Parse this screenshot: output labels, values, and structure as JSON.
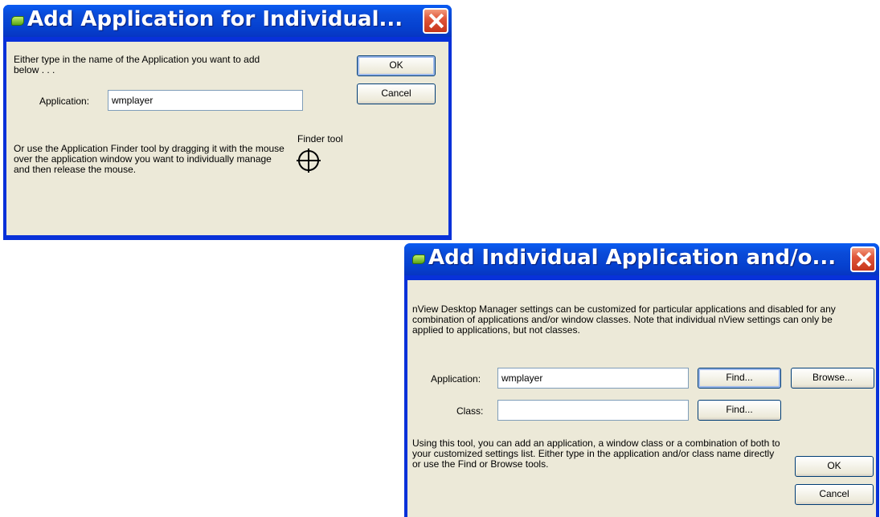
{
  "dialog1": {
    "title": "Add Application for Individual...",
    "intro": "Either type in the name of the Application you want to add below . . .",
    "application_label": "Application:",
    "application_value": "wmplayer",
    "finder_text": "Or use the Application Finder tool by dragging it with the mouse over the application window you want to individually manage and then release the mouse.",
    "finder_label": "Finder tool",
    "ok_label": "OK",
    "cancel_label": "Cancel"
  },
  "dialog2": {
    "title": "Add Individual Application and/o...",
    "intro": "nView Desktop Manager settings can be customized for particular applications and disabled for any combination of applications and/or window classes. Note that individual nView settings can only be applied to applications, but not classes.",
    "application_label": "Application:",
    "application_value": "wmplayer",
    "class_label": "Class:",
    "class_value": "",
    "find_label": "Find...",
    "browse_label": "Browse...",
    "footer_text": "Using this tool, you can add an application, a window class or a combination of both to your customized settings list. Either type in the application and/or class name directly or use the Find or Browse tools.",
    "ok_label": "OK",
    "cancel_label": "Cancel"
  },
  "icons": [
    "app-icon",
    "close-icon",
    "crosshair-icon"
  ]
}
